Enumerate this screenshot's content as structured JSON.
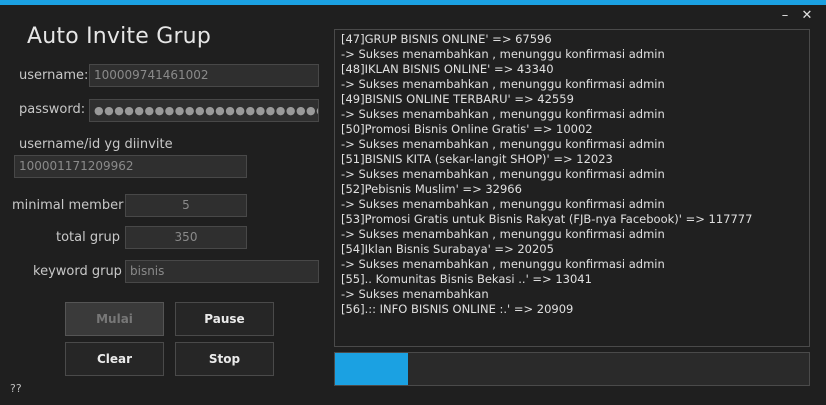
{
  "window": {
    "title": "Auto Invite Grup",
    "minimize_glyph": "–",
    "close_glyph": "✕",
    "accent": "#1ba1e2"
  },
  "form": {
    "username_label": "username:",
    "username_value": "100009741461002",
    "password_label": "password:",
    "password_value": "●●●●●●●●●●●●●●●●●●●●●●●●●●●●●●●●●●●●●●●●●●●●●●●●",
    "target_label": "username/id yg diinvite",
    "target_value": "100001171209962",
    "min_member_label": "minimal member",
    "min_member_value": "5",
    "total_grup_label": "total grup",
    "total_grup_value": "350",
    "keyword_label": "keyword grup",
    "keyword_value": "bisnis"
  },
  "buttons": {
    "mulai": "Mulai",
    "pause": "Pause",
    "clear": "Clear",
    "stop": "Stop"
  },
  "footer": {
    "help": "??"
  },
  "log_lines": [
    "[47]GRUP BISNIS ONLINE' => 67596",
    "-> Sukses menambahkan , menunggu konfirmasi admin",
    "[48]IKLAN  BISNIS ONLINE' => 43340",
    "-> Sukses menambahkan , menunggu konfirmasi admin",
    "[49]BISNIS ONLINE TERBARU' => 42559",
    "-> Sukses menambahkan , menunggu konfirmasi admin",
    "[50]Promosi Bisnis Online Gratis' => 10002",
    "-> Sukses menambahkan , menunggu konfirmasi admin",
    "[51]BISNIS KITA (sekar-langit SHOP)' => 12023",
    "-> Sukses menambahkan , menunggu konfirmasi admin",
    "[52]Pebisnis Muslim' => 32966",
    "-> Sukses menambahkan , menunggu konfirmasi admin",
    "[53]Promosi Gratis untuk Bisnis Rakyat (FJB-nya Facebook)' => 117777",
    "-> Sukses menambahkan , menunggu konfirmasi admin",
    "[54]Iklan Bisnis Surabaya' => 20205",
    "-> Sukses menambahkan , menunggu konfirmasi admin",
    "[55].. Komunitas Bisnis Bekasi ..' => 13041",
    "-> Sukses menambahkan",
    "[56].:: INFO BISNIS ONLINE :.' => 20909"
  ],
  "progress": {
    "fraction": 0.155
  }
}
